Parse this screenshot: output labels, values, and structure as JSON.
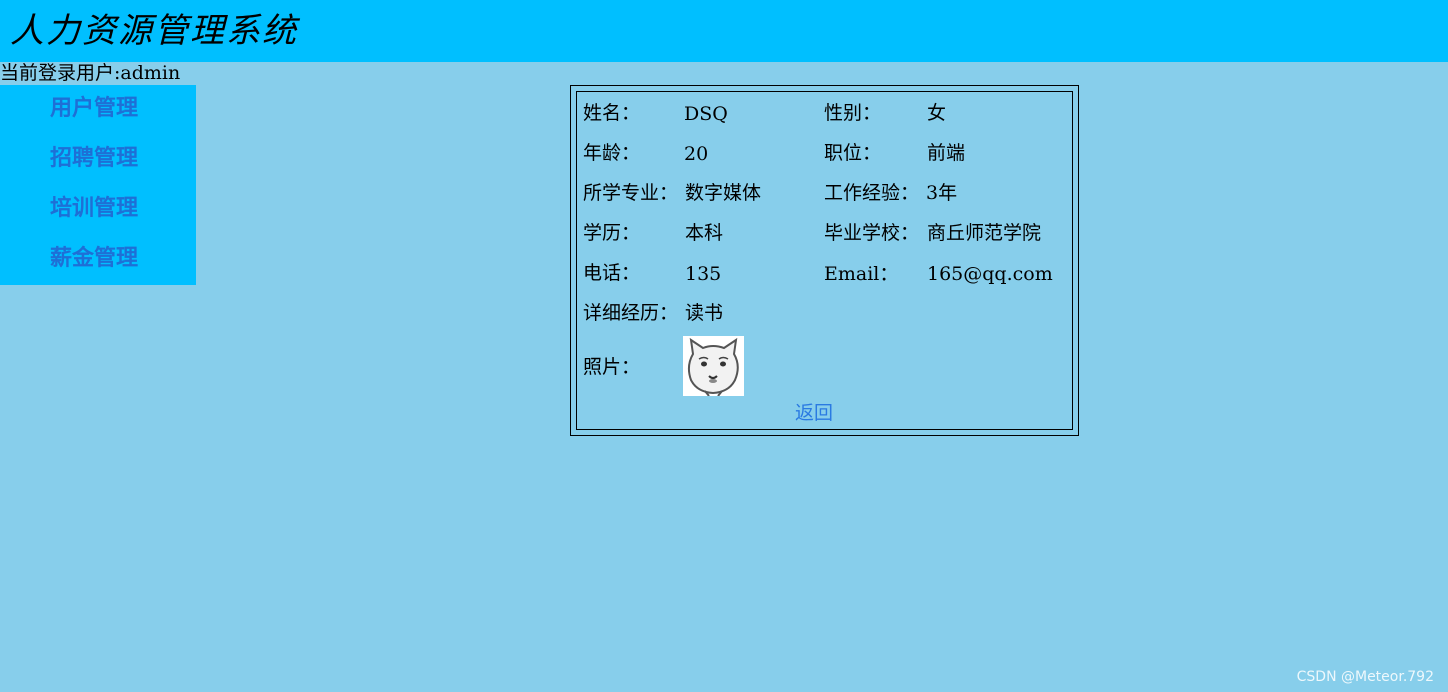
{
  "header": {
    "title": "人力资源管理系统"
  },
  "login": {
    "text": "当前登录用户:admin"
  },
  "sidebar": {
    "items": [
      {
        "label": "用户管理"
      },
      {
        "label": "招聘管理"
      },
      {
        "label": "培训管理"
      },
      {
        "label": "薪金管理"
      }
    ]
  },
  "detail": {
    "name_label": "姓名：",
    "name_value": "DSQ",
    "gender_label": "性别：",
    "gender_value": "女",
    "age_label": "年龄：",
    "age_value": "20",
    "position_label": "职位：",
    "position_value": "前端",
    "major_label": "所学专业：",
    "major_value": "数字媒体",
    "experience_label": "工作经验：",
    "experience_value": "3年",
    "education_label": "学历：",
    "education_value": "本科",
    "school_label": "毕业学校：",
    "school_value": "商丘师范学院",
    "phone_label": "电话：",
    "phone_value": "135",
    "email_label": "Email：",
    "email_value": "165@qq.com",
    "history_label": "详细经历：",
    "history_value": "读书",
    "photo_label": "照片：",
    "return_label": "返回"
  },
  "watermark": "CSDN @Meteor.792",
  "colors": {
    "header_bg": "#00bfff",
    "page_bg": "#87ceeb",
    "sidebar_bg": "#00bfff",
    "nav_text": "#1e6fd6",
    "link": "#2a7ae2"
  }
}
